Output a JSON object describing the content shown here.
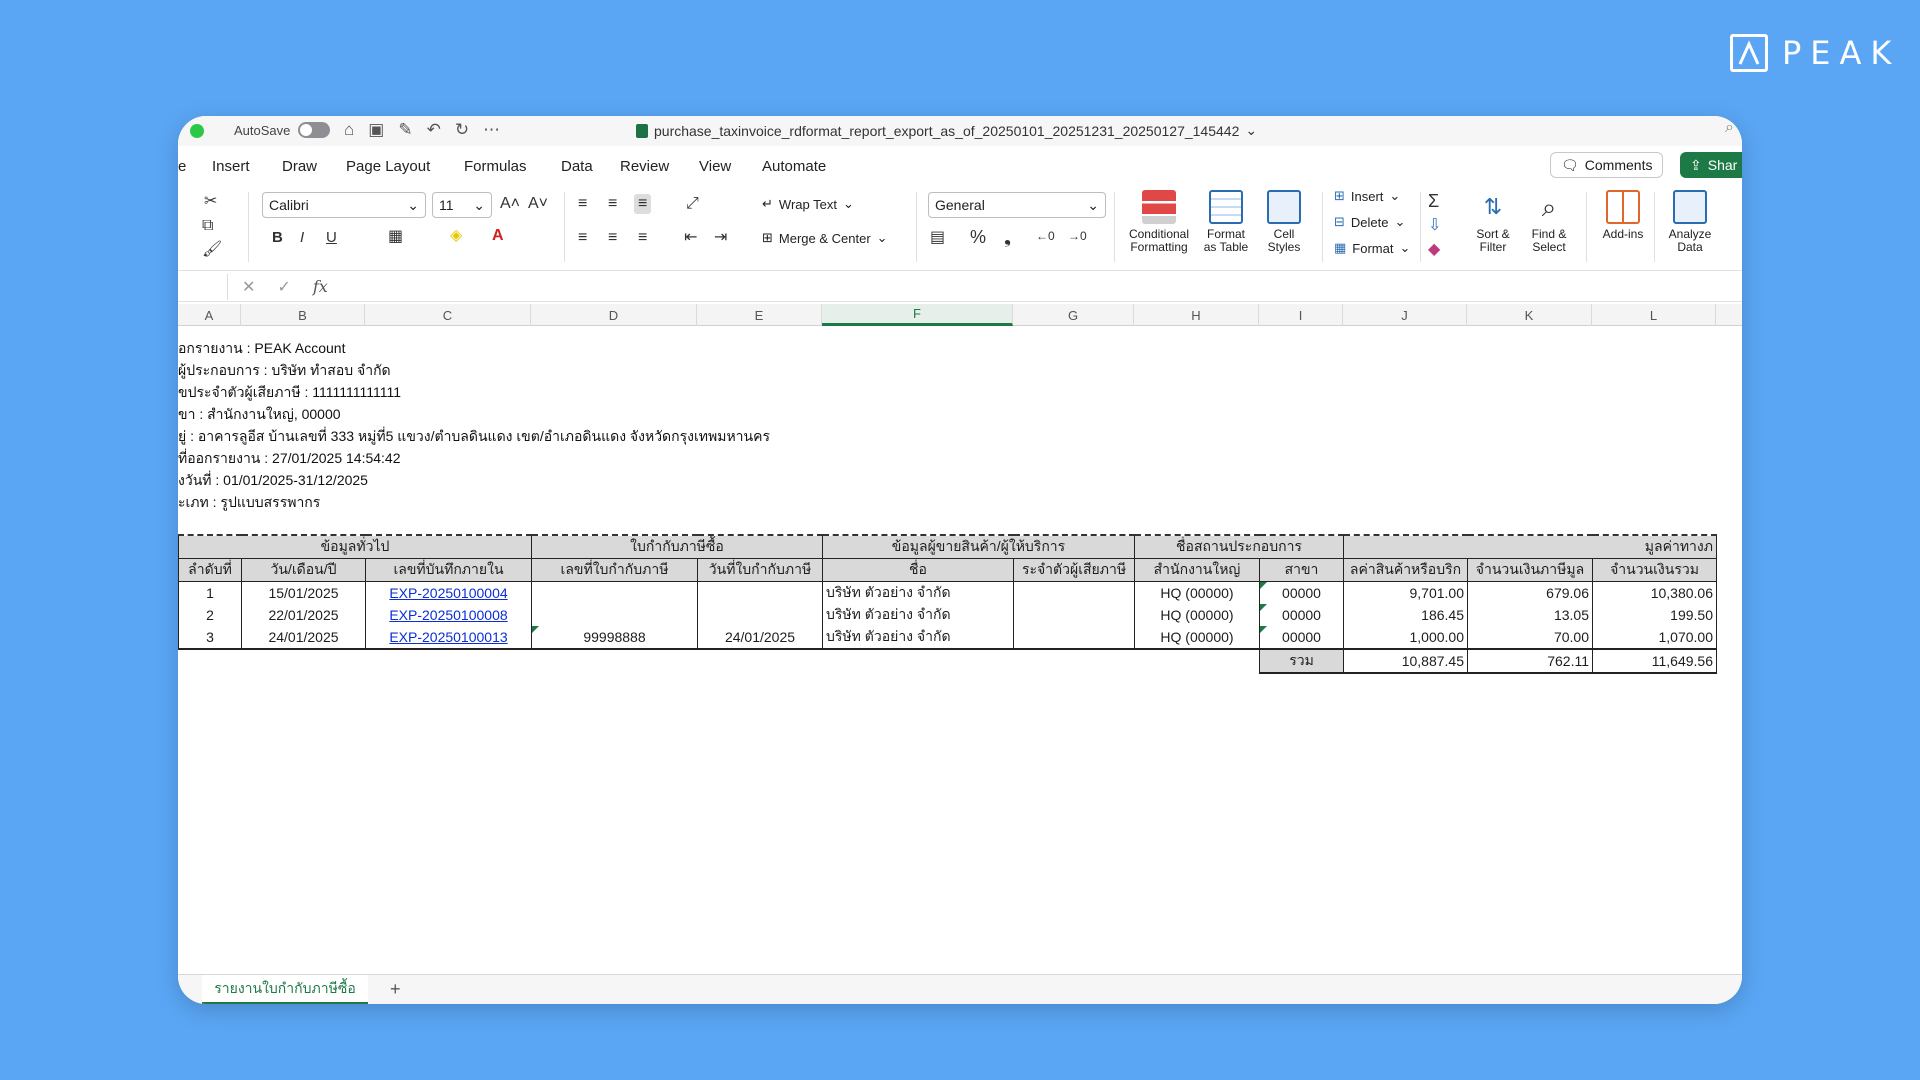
{
  "brand": {
    "logo_text": "PEAK"
  },
  "titlebar": {
    "autosave_label": "AutoSave",
    "document_title": "purchase_taxinvoice_rdformat_report_export_as_of_20250101_20251231_20250127_145442"
  },
  "tabs": [
    "e",
    "Insert",
    "Draw",
    "Page Layout",
    "Formulas",
    "Data",
    "Review",
    "View",
    "Automate"
  ],
  "actions": {
    "comments": "Comments",
    "share": "Shar"
  },
  "ribbon": {
    "font_name": "Calibri",
    "font_size": "11",
    "wrap_text": "Wrap Text",
    "merge_center": "Merge & Center",
    "number_format": "General",
    "conditional_formatting": [
      "Conditional",
      "Formatting"
    ],
    "format_as_table": [
      "Format",
      "as Table"
    ],
    "cell_styles": [
      "Cell",
      "Styles"
    ],
    "insert": "Insert",
    "delete": "Delete",
    "format": "Format",
    "sort_filter": [
      "Sort &",
      "Filter"
    ],
    "find_select": [
      "Find &",
      "Select"
    ],
    "add_ins": "Add-ins",
    "analyze_data": [
      "Analyze",
      "Data"
    ]
  },
  "formula_bar": {
    "fx": "fx"
  },
  "columns": [
    "A",
    "B",
    "C",
    "D",
    "E",
    "F",
    "G",
    "H",
    "I",
    "J",
    "K",
    "L"
  ],
  "active_column": "F",
  "report_info": [
    "อกรายงาน : PEAK Account",
    "ผู้ประกอบการ : บริษัท ทำสอบ จำกัด",
    "ขประจำตัวผู้เสียภาษี : 1111111111111",
    "ขา : สำนักงานใหญ่, 00000",
    "ยู่ : อาคารลูอีส บ้านเลขที่ 333 หมู่ที่5 แขวง/ตำบลดินแดง เขต/อำเภอดินแดง จังหวัดกรุงเทพมหานคร",
    "ที่ออกรายงาน : 27/01/2025 14:54:42",
    "งวันที่ : 01/01/2025-31/12/2025",
    "ะเภท : รูปแบบสรรพากร"
  ],
  "table": {
    "group_headers": [
      "ข้อมูลทั่วไป",
      "ใบกำกับภาษีซื้อ",
      "ข้อมูลผู้ขายสินค้า/ผู้ให้บริการ",
      "ชื่อสถานประกอบการ",
      "มูลค่าทางภ"
    ],
    "headers": [
      "ลำดับที่",
      "วัน/เดือน/ปี",
      "เลขที่บันทึกภายใน",
      "เลขที่ใบกำกับภาษี",
      "วันที่ใบกำกับภาษี",
      "ชื่อ",
      "ระจำตัวผู้เสียภาษี",
      "สำนักงานใหญ่",
      "สาขา",
      "ลค่าสินค้าหรือบริก",
      "จำนวนเงินภาษีมูล",
      "จำนวนเงินรวม"
    ],
    "rows": [
      {
        "no": "1",
        "date": "15/01/2025",
        "ref": "EXP-20250100004",
        "invoice_no": "",
        "invoice_date": "",
        "name": "บริษัท ตัวอย่าง จำกัด",
        "tax_id": "",
        "hq": "HQ (00000)",
        "branch": "00000",
        "amount": "9,701.00",
        "vat": "679.06",
        "total": "10,380.06"
      },
      {
        "no": "2",
        "date": "22/01/2025",
        "ref": "EXP-20250100008",
        "invoice_no": "",
        "invoice_date": "",
        "name": "บริษัท ตัวอย่าง จำกัด",
        "tax_id": "",
        "hq": "HQ (00000)",
        "branch": "00000",
        "amount": "186.45",
        "vat": "13.05",
        "total": "199.50"
      },
      {
        "no": "3",
        "date": "24/01/2025",
        "ref": "EXP-20250100013",
        "invoice_no": "99998888",
        "invoice_date": "24/01/2025",
        "name": "บริษัท ตัวอย่าง จำกัด",
        "tax_id": "",
        "hq": "HQ (00000)",
        "branch": "00000",
        "amount": "1,000.00",
        "vat": "70.00",
        "total": "1,070.00"
      }
    ],
    "totals": {
      "label": "รวม",
      "amount": "10,887.45",
      "vat": "762.11",
      "total": "11,649.56"
    }
  },
  "sheet_tabs": {
    "active": "รายงานใบกำกับภาษีซื้อ",
    "add": "+"
  },
  "colors": {
    "excel_green": "#1d7a46",
    "background": "#5aa6f5",
    "link": "#0b2ed6"
  }
}
